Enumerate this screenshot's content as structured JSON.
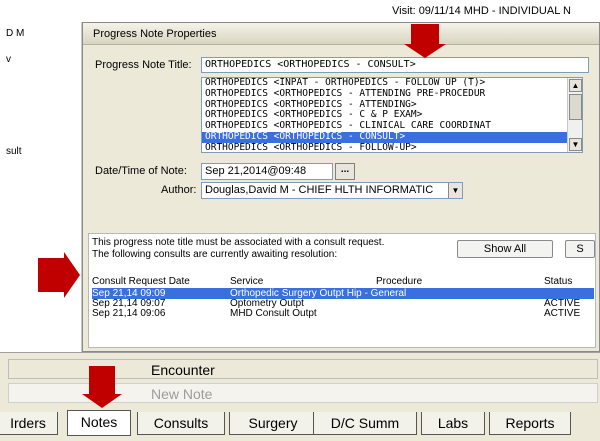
{
  "app": {
    "visit_text": "Visit: 09/11/14   MHD - INDIVIDUAL N",
    "left_fragments": [
      "D M",
      "v",
      "sult"
    ]
  },
  "dialog": {
    "title": "Progress Note Properties",
    "title_label": "Progress Note Title:",
    "title_value": "ORTHOPEDICS  <ORTHOPEDICS - CONSULT>",
    "title_options": [
      "ORTHOPEDICS  <INPAT - ORTHOPEDICS - FOLLOW UP (T)>",
      "ORTHOPEDICS  <ORTHOPEDICS - ATTENDING PRE-PROCEDUR",
      "ORTHOPEDICS  <ORTHOPEDICS - ATTENDING>",
      "ORTHOPEDICS  <ORTHOPEDICS - C & P EXAM>",
      "ORTHOPEDICS  <ORTHOPEDICS - CLINICAL CARE COORDINAT",
      "ORTHOPEDICS  <ORTHOPEDICS - CONSULT>",
      "ORTHOPEDICS  <ORTHOPEDICS - FOLLOW-UP>"
    ],
    "selected_index": 5,
    "date_label": "Date/Time of Note:",
    "date_value": "Sep 21,2014@09:48",
    "date_button": "...",
    "author_label": "Author:",
    "author_value": "Douglas,David M - CHIEF HLTH INFORMATIC",
    "scroll_up": "▲",
    "scroll_down": "▼",
    "drop_arrow": "▼"
  },
  "consults": {
    "message_line1": "This progress note title must be associated with a consult request.",
    "message_line2": "The following consults are currently awaiting resolution:",
    "show_all_label": "Show All",
    "extra_button_label": "S",
    "columns": [
      "Consult Request Date",
      "Service",
      "Procedure",
      "Status"
    ],
    "rows": [
      {
        "date": "Sep 21,14 09:09",
        "service": "Orthopedic Surgery Outpt Hip - General",
        "procedure": "",
        "status": ""
      },
      {
        "date": "Sep 21,14 09:07",
        "service": "Optometry Outpt",
        "procedure": "",
        "status": "ACTIVE"
      },
      {
        "date": "Sep 21,14 09:06",
        "service": "MHD Consult Outpt",
        "procedure": "",
        "status": "ACTIVE"
      }
    ]
  },
  "lower": {
    "encounter_label": "Encounter",
    "new_note_label": "New Note"
  },
  "tabs": [
    {
      "label": "Orders",
      "display": "Irders"
    },
    {
      "label": "Notes",
      "display": "Notes"
    },
    {
      "label": "Consults",
      "display": "Consults"
    },
    {
      "label": "Surgery",
      "display": "Surgery"
    },
    {
      "label": "D/C Summ",
      "display": "D/C Summ"
    },
    {
      "label": "Labs",
      "display": "Labs"
    },
    {
      "label": "Reports",
      "display": "Reports"
    }
  ],
  "colors": {
    "selection": "#3a6fe0",
    "callout": "#c00000",
    "dialog_bg": "#ece9d8"
  }
}
